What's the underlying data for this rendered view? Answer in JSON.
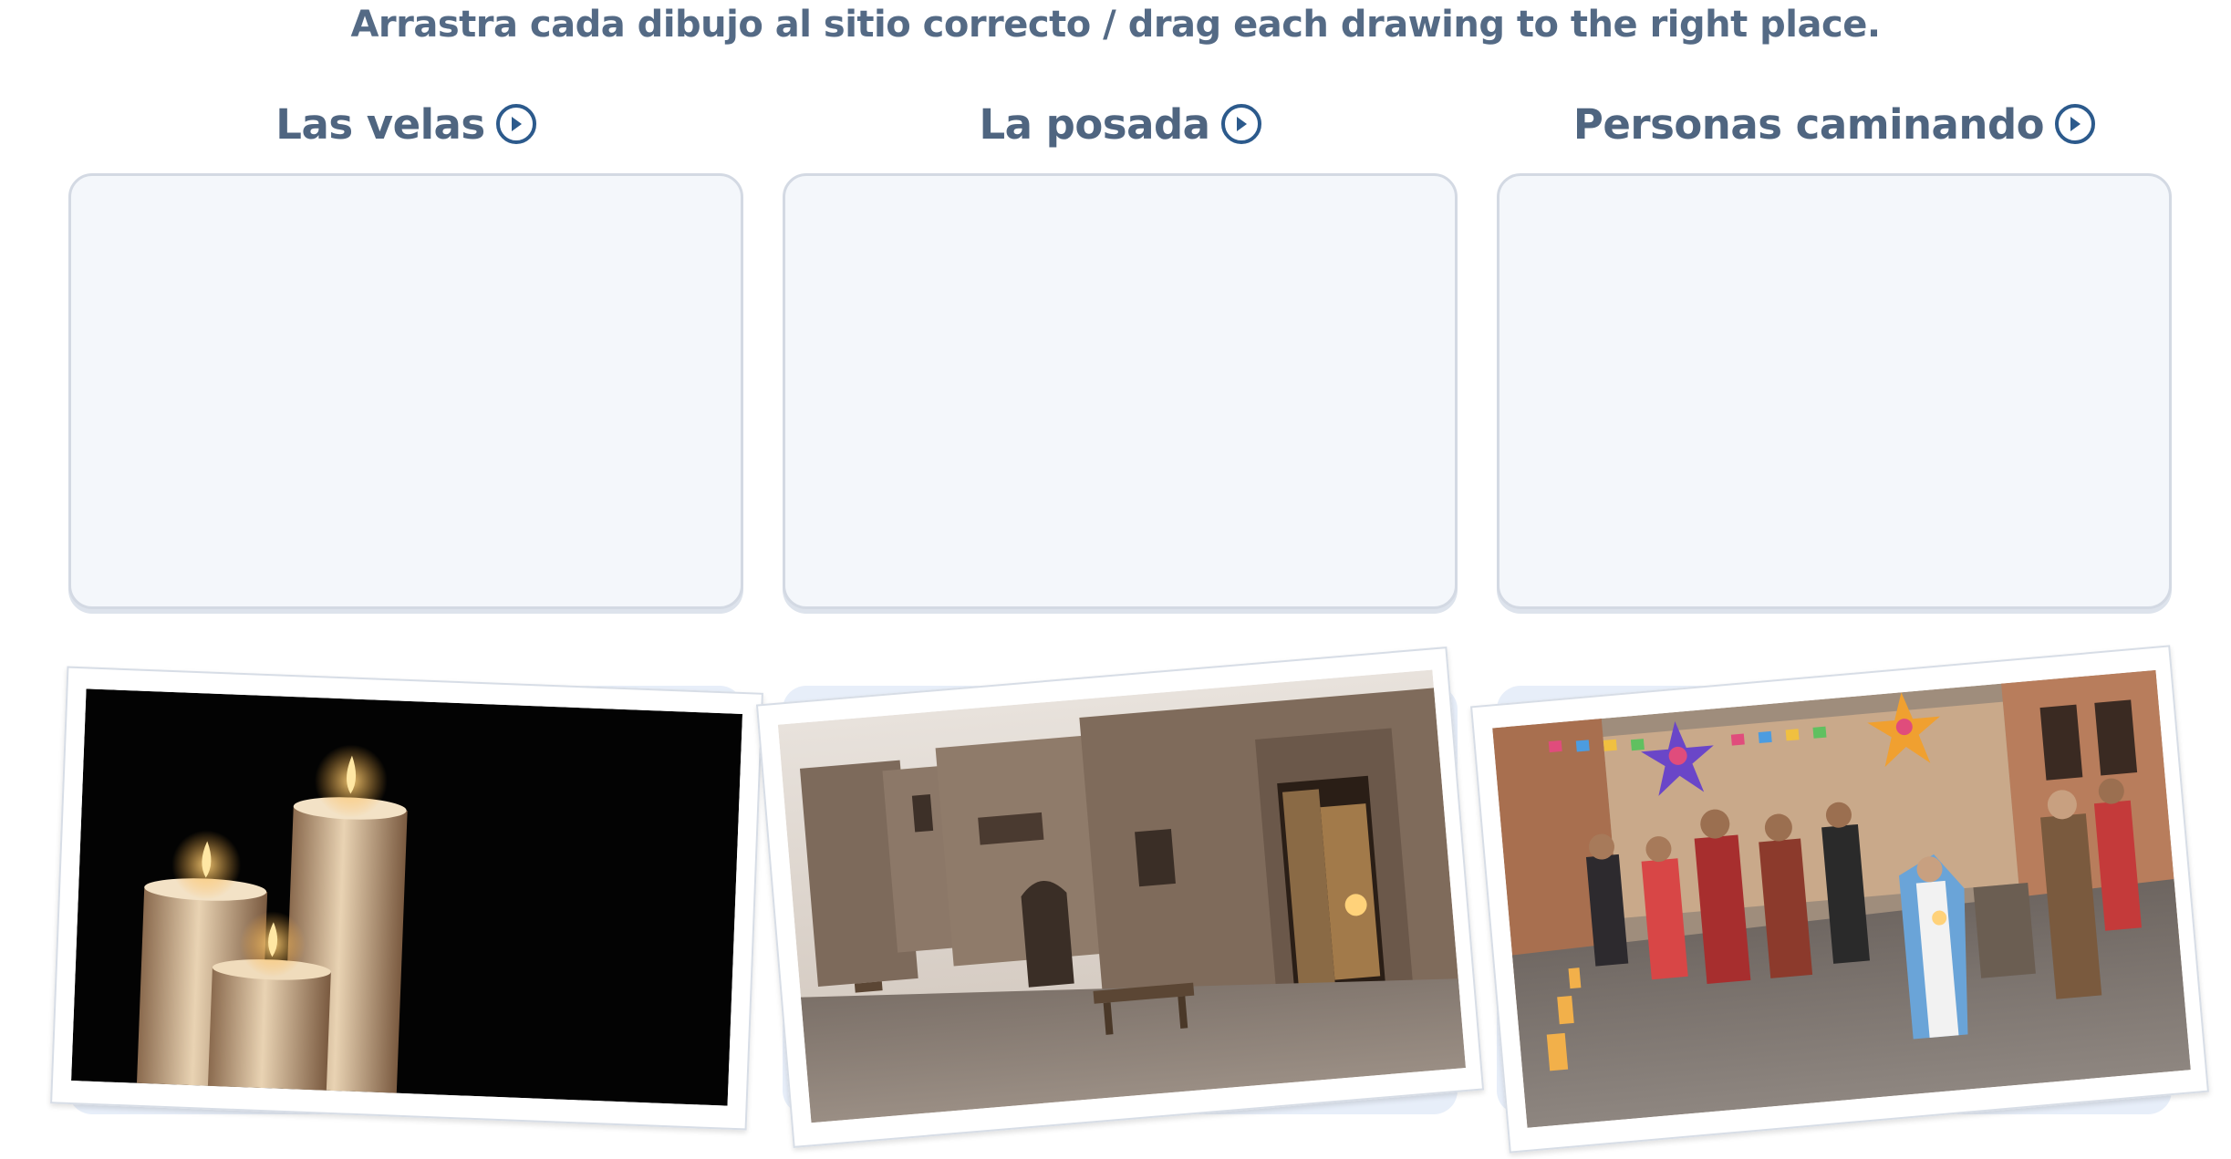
{
  "instruction": "Arrastra cada dibujo al sitio correcto / drag each drawing to the right place.",
  "columns": [
    {
      "label": "Las velas"
    },
    {
      "label": "La posada"
    },
    {
      "label": "Personas caminando"
    }
  ],
  "colors": {
    "text": "#4f6580",
    "accent": "#2c5a8c",
    "drop_zone_bg": "#f4f7fb",
    "drop_zone_border": "#d3d9e3",
    "card_bg": "#e7eef9"
  },
  "icons": {
    "play": "play-circle-icon"
  },
  "drawings": [
    {
      "subject": "candles-photo"
    },
    {
      "subject": "adobe-street-posada-photo"
    },
    {
      "subject": "procession-people-walking-photo"
    }
  ]
}
